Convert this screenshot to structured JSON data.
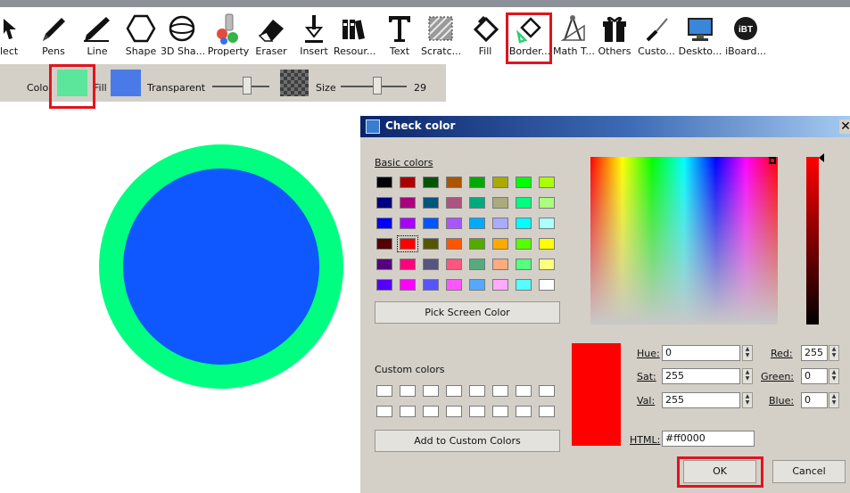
{
  "toolbar": {
    "tools": [
      {
        "label": "lect",
        "icon": "select-arrow-icon"
      },
      {
        "label": "Pens",
        "icon": "pen-icon"
      },
      {
        "label": "Line",
        "icon": "line-icon"
      },
      {
        "label": "Shape",
        "icon": "hexagon-shape-icon"
      },
      {
        "label": "3D Sha...",
        "icon": "sphere-3d-icon"
      },
      {
        "label": "Property",
        "icon": "property-palette-icon"
      },
      {
        "label": "Eraser",
        "icon": "eraser-icon"
      },
      {
        "label": "Insert",
        "icon": "insert-download-icon"
      },
      {
        "label": "Resour...",
        "icon": "resources-books-icon"
      },
      {
        "label": "Text",
        "icon": "text-t-icon"
      },
      {
        "label": "Scratc...",
        "icon": "scratch-icon"
      },
      {
        "label": "Fill",
        "icon": "fill-bucket-icon"
      },
      {
        "label": "Border...",
        "icon": "border-bucket-icon"
      },
      {
        "label": "Math T...",
        "icon": "math-tools-compass-icon"
      },
      {
        "label": "Others",
        "icon": "gift-box-icon"
      },
      {
        "label": "Custo...",
        "icon": "custom-screwdriver-icon"
      },
      {
        "label": "Deskto...",
        "icon": "desktop-monitor-icon"
      },
      {
        "label": "iBoard...",
        "icon": "iboard-ibt-icon"
      }
    ]
  },
  "property_bar": {
    "color_label": "Colo",
    "fill_label": "Fill",
    "transparent_label": "Transparent",
    "size_label": "Size",
    "size_value": "29",
    "border_color": "#5ce69b",
    "fill_color": "#4a7ae8"
  },
  "canvas": {
    "circle_border_color": "#00ff80",
    "circle_fill_color": "#0f58ff"
  },
  "dialog": {
    "title": "Check color",
    "close_label": "✕",
    "basic_colors_label": "Basic colors",
    "basic_colors": [
      "#000000",
      "#aa0000",
      "#005500",
      "#aa5500",
      "#00aa00",
      "#aaaa00",
      "#00ff00",
      "#aaff00",
      "#000080",
      "#aa007f",
      "#00557f",
      "#aa557f",
      "#00aa7f",
      "#aaaa7f",
      "#00ff7f",
      "#aaff7f",
      "#0000ff",
      "#aa00ff",
      "#0055ff",
      "#aa55ff",
      "#00aaff",
      "#aaaaff",
      "#00ffff",
      "#aaffff",
      "#550000",
      "#ff0000",
      "#555500",
      "#ff5500",
      "#55aa00",
      "#ffaa00",
      "#55ff00",
      "#ffff00",
      "#55007f",
      "#ff007f",
      "#55557f",
      "#ff557f",
      "#55aa7f",
      "#ffaa7f",
      "#55ff7f",
      "#ffff7f",
      "#5500ff",
      "#ff00ff",
      "#5555ff",
      "#ff55ff",
      "#55aaff",
      "#ffaaff",
      "#55ffff",
      "#ffffff"
    ],
    "pick_screen_label": "Pick Screen Color",
    "custom_colors_label": "Custom colors",
    "add_custom_label": "Add to Custom Colors",
    "current_color": "#ff0000",
    "hue_label": "Hue:",
    "hue_value": "0",
    "sat_label": "Sat:",
    "sat_value": "255",
    "val_label": "Val:",
    "val_value": "255",
    "red_label": "Red:",
    "red_value": "255",
    "green_label": "Green:",
    "green_value": "0",
    "blue_label": "Blue:",
    "blue_value": "0",
    "html_label": "HTML:",
    "html_value": "#ff0000",
    "ok_label": "OK",
    "cancel_label": "Cancel"
  }
}
